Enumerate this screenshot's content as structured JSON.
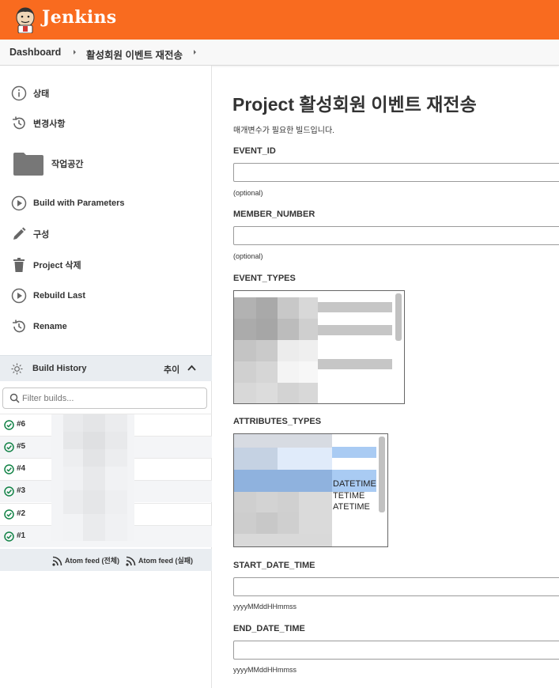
{
  "header": {
    "app_name": "Jenkins"
  },
  "breadcrumb": {
    "items": [
      "Dashboard",
      "활성회원 이벤트 재전송"
    ]
  },
  "sidebar": {
    "items": [
      {
        "label": "상태",
        "icon": "info-icon"
      },
      {
        "label": "변경사항",
        "icon": "history-icon"
      },
      {
        "label": "작업공간",
        "icon": "folder-icon"
      },
      {
        "label": "Build with Parameters",
        "icon": "play-icon"
      },
      {
        "label": "구성",
        "icon": "pencil-icon"
      },
      {
        "label": "Project 삭제",
        "icon": "trash-icon"
      },
      {
        "label": "Rebuild Last",
        "icon": "play-icon"
      },
      {
        "label": "Rename",
        "icon": "history-icon"
      }
    ]
  },
  "build_history": {
    "title": "Build History",
    "trend_label": "추이",
    "filter_placeholder": "Filter builds...",
    "builds": [
      "#6",
      "#5",
      "#4",
      "#3",
      "#2",
      "#1"
    ],
    "feed_all": "Atom feed (전체)",
    "feed_failed": "Atom feed (실패)"
  },
  "main": {
    "title": "Project 활성회원 이벤트 재전송",
    "description": "매개변수가 필요한 빌드입니다.",
    "params": [
      {
        "name": "EVENT_ID",
        "hint": "(optional)",
        "value": ""
      },
      {
        "name": "MEMBER_NUMBER",
        "hint": "(optional)",
        "value": ""
      },
      {
        "name": "EVENT_TYPES"
      },
      {
        "name": "ATTRIBUTES_TYPES",
        "visible_options": [
          "DATETIME",
          "TETIME",
          "ATETIME"
        ]
      },
      {
        "name": "START_DATE_TIME",
        "hint": "yyyyMMddHHmmss",
        "value": ""
      },
      {
        "name": "END_DATE_TIME",
        "hint": "yyyyMMddHHmmss",
        "value": ""
      }
    ]
  },
  "colors": {
    "header": "#f96b1f",
    "success": "#138347",
    "selection": "#a9cbf3",
    "selection_dark": "#8fb2de"
  }
}
